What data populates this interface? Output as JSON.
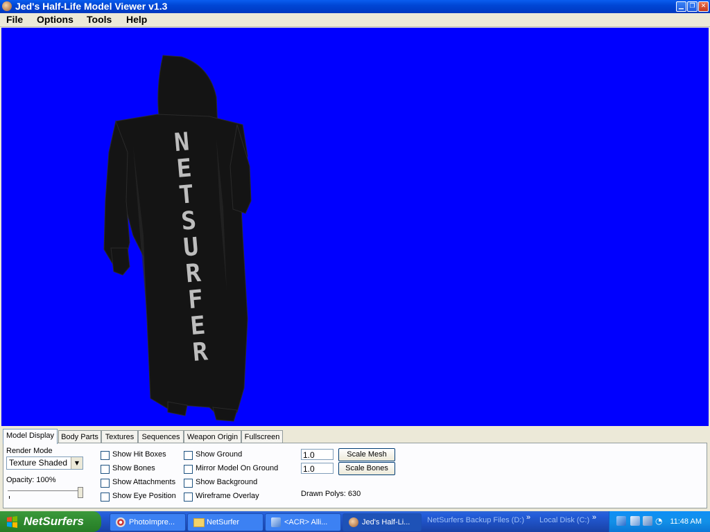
{
  "window": {
    "title": "Jed's Half-Life Model Viewer v1.3"
  },
  "menu": [
    "File",
    "Options",
    "Tools",
    "Help"
  ],
  "viewport": {
    "background": "#0000ff",
    "model_text": "NETSURFER"
  },
  "tabs": [
    "Model Display",
    "Body Parts",
    "Textures",
    "Sequences",
    "Weapon Origin",
    "Fullscreen"
  ],
  "model_display": {
    "render_mode_label": "Render Mode",
    "render_mode_value": "Texture Shaded",
    "opacity_label": "Opacity: 100%",
    "opacity": 1.0,
    "checkboxes_col1": [
      "Show Hit Boxes",
      "Show Bones",
      "Show Attachments",
      "Show Eye Position"
    ],
    "checkboxes_col2": [
      "Show Ground",
      "Mirror Model On Ground",
      "Show Background",
      "Wireframe Overlay"
    ],
    "scale_mesh_value": "1.0",
    "scale_bones_value": "1.0",
    "scale_mesh_label": "Scale Mesh",
    "scale_bones_label": "Scale Bones",
    "drawn_polys": "Drawn Polys: 630"
  },
  "taskbar": {
    "start_label": "NetSurfers",
    "buttons": [
      "PhotoImpre...",
      "NetSurfer",
      "<ACR> Alli...",
      "Jed's Half-Li..."
    ],
    "links": [
      "NetSurfers Backup Files (D:)",
      "Local Disk (C:)"
    ],
    "chevron": "»",
    "clock": "11:48 AM"
  }
}
